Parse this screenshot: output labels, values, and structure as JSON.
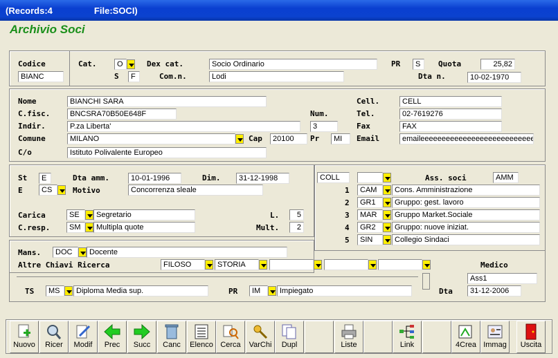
{
  "window": {
    "records": "(Records:4",
    "file": "File:SOCI)"
  },
  "app_title": "Archivio Soci",
  "top": {
    "codice_label": "Codice",
    "codice": "BIANC",
    "cat_label": "Cat.",
    "cat": "O",
    "s_label": "S",
    "s": "F",
    "dexcat_label": "Dex cat.",
    "dexcat": "Socio Ordinario",
    "comn_label": "Com.n.",
    "comn": "Lodi",
    "pr_label": "PR",
    "pr": "S",
    "quota_label": "Quota",
    "quota": "25,82",
    "dtan_label": "Dta n.",
    "dtan": "10-02-1970"
  },
  "anag": {
    "nome_label": "Nome",
    "nome": "BIANCHI SARA",
    "cfisc_label": "C.fisc.",
    "cfisc": "BNCSRA70B50E648F",
    "num_label": "Num.",
    "num": "3",
    "indir_label": "Indir.",
    "indir": "P.za Liberta'",
    "comune_label": "Comune",
    "comune": "MILANO",
    "cap_label": "Cap",
    "cap": "20100",
    "pr_label": "Pr",
    "pr": "MI",
    "co_label": "C/o",
    "co": "Istituto Polivalente Europeo",
    "cell_label": "Cell.",
    "cell": "CELL",
    "tel_label": "Tel.",
    "tel": "02-7619276",
    "fax_label": "Fax",
    "fax": "FAX",
    "email_label": "Email",
    "email": "emaileeeeeeeeeeeeeeeeeeeeeeeeeee"
  },
  "status": {
    "st_label": "St",
    "st": "E",
    "dtaamm_label": "Dta amm.",
    "dtaamm": "10-01-1996",
    "dim_label": "Dim.",
    "dim": "31-12-1998",
    "e_label": "E",
    "e": "CS",
    "motivo_label": "Motivo",
    "motivo": "Concorrenza sleale",
    "carica_label": "Carica",
    "carica_code": "SE",
    "carica": "Segretario",
    "l_label": "L.",
    "l": "5",
    "cresp_label": "C.resp.",
    "cresp_code": "SM",
    "cresp": "Multipla quote",
    "mult_label": "Mult.",
    "mult": "2"
  },
  "assoc": {
    "coll": "COLL",
    "blank": "",
    "label": "Ass. soci",
    "amm": "AMM",
    "rows": [
      {
        "n": "1",
        "code": "CAM",
        "desc": "Cons. Amministrazione"
      },
      {
        "n": "2",
        "code": "GR1",
        "desc": "Gruppo: gest. lavoro"
      },
      {
        "n": "3",
        "code": "MAR",
        "desc": "Gruppo Market.Sociale"
      },
      {
        "n": "4",
        "code": "GR2",
        "desc": "Gruppo: nuove iniziat."
      },
      {
        "n": "5",
        "code": "SIN",
        "desc": "Collegio Sindaci"
      }
    ]
  },
  "bottom": {
    "mans_label": "Mans.",
    "mans_code": "DOC",
    "mans": "Docente",
    "chiavi_label": "Altre Chiavi Ricerca",
    "k1": "FILOSO",
    "k2": "STORIA",
    "k3": "",
    "k4": "",
    "k5": "",
    "medico_label": "Medico",
    "medico": "Ass1",
    "ts_label": "TS",
    "ts_code": "MS",
    "ts": "Diploma Media sup.",
    "pr_label": "PR",
    "pr_code": "IM",
    "pr": "Impiegato",
    "dta_label": "Dta",
    "dta": "31-12-2006"
  },
  "toolbar": [
    {
      "label": "Nuovo",
      "icon": "new-doc-icon"
    },
    {
      "label": "Ricer",
      "icon": "search-icon"
    },
    {
      "label": "Modif",
      "icon": "edit-icon"
    },
    {
      "label": "Prec",
      "icon": "arrow-left-icon"
    },
    {
      "label": "Succ",
      "icon": "arrow-right-icon"
    },
    {
      "label": "Canc",
      "icon": "trash-icon"
    },
    {
      "label": "Elenco",
      "icon": "list-icon"
    },
    {
      "label": "Cerca",
      "icon": "find-icon"
    },
    {
      "label": "VarChi",
      "icon": "keys-icon"
    },
    {
      "label": "Dupl",
      "icon": "duplicate-icon"
    },
    {
      "label": "",
      "icon": ""
    },
    {
      "label": "Liste",
      "icon": "printer-icon"
    },
    {
      "label": "",
      "icon": ""
    },
    {
      "label": "Link",
      "icon": "tree-icon"
    },
    {
      "label": "",
      "icon": ""
    },
    {
      "label": "4Crea",
      "icon": "create-icon"
    },
    {
      "label": "Immag",
      "icon": "image-icon"
    },
    {
      "label": "",
      "icon": ""
    },
    {
      "label": "Uscita",
      "icon": "exit-icon"
    }
  ],
  "colors": {
    "title_green": "#1a8f1a",
    "dropdown": "#ffee00",
    "titlebar": "#0a3fd0"
  }
}
